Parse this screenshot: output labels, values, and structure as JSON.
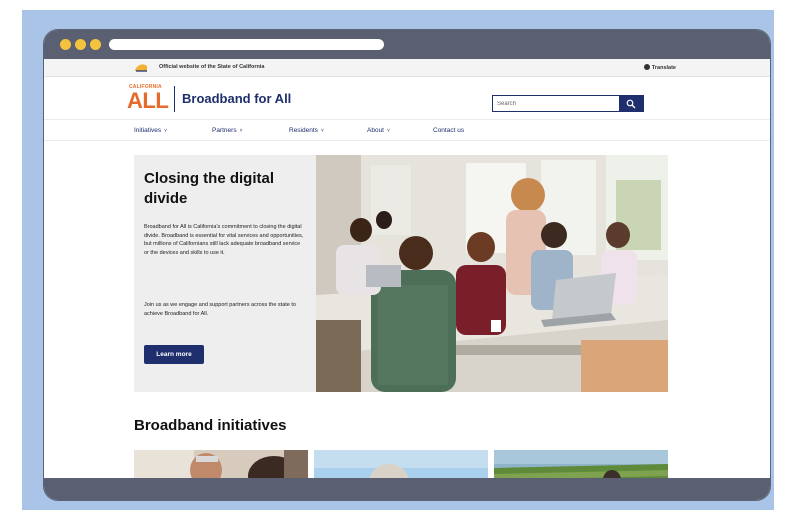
{
  "gov_bar": {
    "official_text": "Official website of the State of California",
    "translate_label": "Translate"
  },
  "header": {
    "logo_small": "CALIFORNIA",
    "logo_big": "ALL",
    "site_title": "Broadband for All",
    "search_placeholder": "Search"
  },
  "nav": {
    "items": [
      {
        "label": "Initiatives",
        "has_dropdown": true
      },
      {
        "label": "Partners",
        "has_dropdown": true
      },
      {
        "label": "Residents",
        "has_dropdown": true
      },
      {
        "label": "About",
        "has_dropdown": true
      },
      {
        "label": "Contact us",
        "has_dropdown": false
      }
    ],
    "dropdown_glyph": "˅"
  },
  "hero": {
    "title": "Closing the digital divide",
    "paragraph1": "Broadband for All is California's commitment to closing the digital divide. Broadband is essential for vital services and opportunities, but millions of Californians still lack adequate broadband service or the devices and skills to use it.",
    "paragraph2": "Join us as we engage and support partners across the state to achieve Broadband for All.",
    "button_label": "Learn more"
  },
  "initiatives": {
    "title": "Broadband initiatives"
  },
  "colors": {
    "brand_navy": "#1f2f6e",
    "brand_orange": "#e66b2a",
    "frame_blue": "#a9c4e6",
    "browser_chrome": "#5a6072",
    "window_dot": "#f3c23e"
  }
}
